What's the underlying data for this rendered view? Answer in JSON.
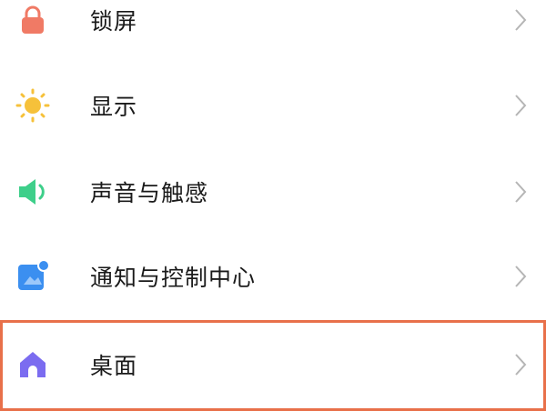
{
  "settings_list": {
    "items": [
      {
        "label": "锁屏",
        "icon": "lock-icon",
        "icon_color": "#f07a65"
      },
      {
        "label": "显示",
        "icon": "sun-icon",
        "icon_color": "#f6c13a"
      },
      {
        "label": "声音与触感",
        "icon": "speaker-icon",
        "icon_color": "#3ecf8a"
      },
      {
        "label": "通知与控制中心",
        "icon": "notification-icon",
        "icon_color": "#3b8ff0"
      },
      {
        "label": "桌面",
        "icon": "home-icon",
        "icon_color": "#7b6cf0"
      }
    ],
    "highlight_color": "#e8704a"
  }
}
